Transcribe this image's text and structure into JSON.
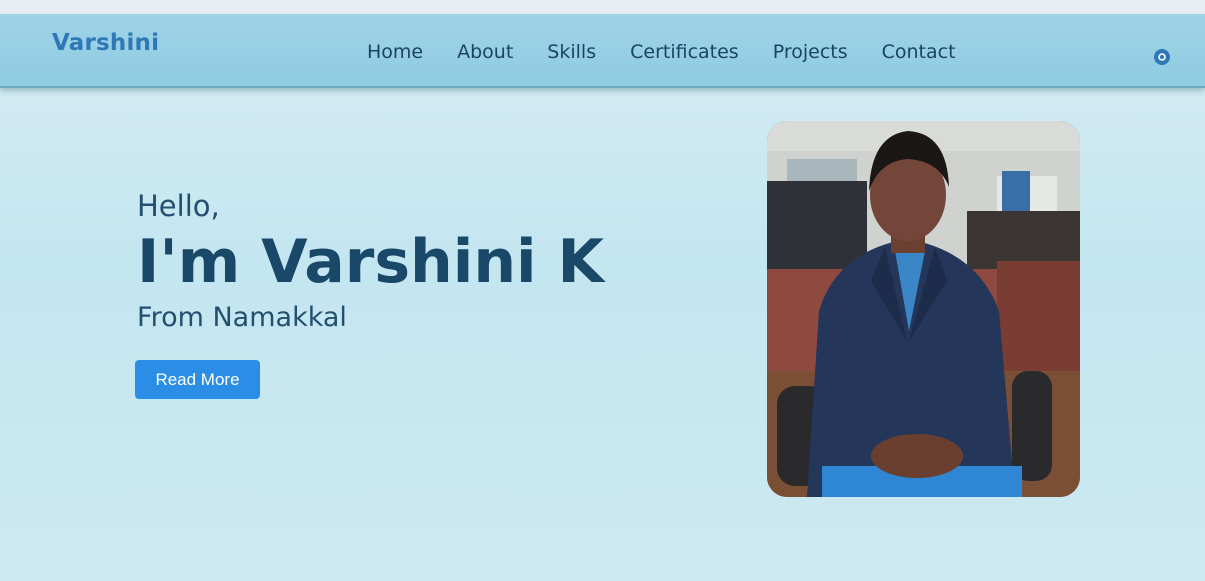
{
  "navbar": {
    "brand": "Varshini",
    "links": [
      "Home",
      "About",
      "Skills",
      "Certificates",
      "Projects",
      "Contact"
    ],
    "github_icon": "github-icon"
  },
  "hero": {
    "greeting": "Hello,",
    "headline": "I'm Varshini K",
    "origin": "From Namakkal",
    "button_label": "Read More"
  },
  "colors": {
    "brand": "#2f78b8",
    "text": "#1a4868",
    "button": "#2b8ee6",
    "navbar": "#9fd3e6"
  }
}
